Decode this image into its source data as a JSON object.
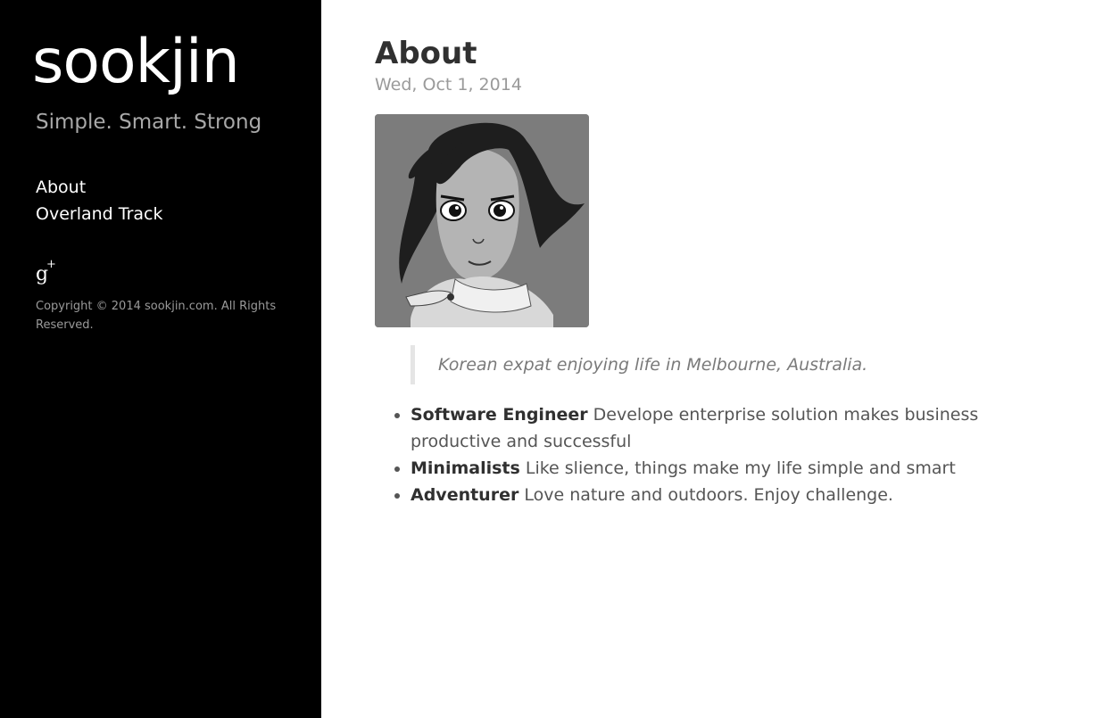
{
  "sidebar": {
    "site_title": "sookjin",
    "tagline": "Simple. Smart. Strong",
    "nav": [
      {
        "label": "About"
      },
      {
        "label": "Overland Track"
      }
    ],
    "social_icon": "google-plus-icon",
    "copyright": "Copyright © 2014 sookjin.com. All Rights Reserved."
  },
  "post": {
    "title": "About",
    "date": "Wed, Oct 1, 2014",
    "quote": "Korean expat enjoying life in Melbourne, Australia.",
    "traits": [
      {
        "term": "Software Engineer",
        "desc": " Develope enterprise solution makes business productive and successful"
      },
      {
        "term": "Minimalists",
        "desc": " Like slience, things make my life simple and smart"
      },
      {
        "term": "Adventurer",
        "desc": " Love nature and outdoors. Enjoy challenge."
      }
    ]
  },
  "colors": {
    "sidebar_bg": "#000000",
    "content_bg": "#ffffff",
    "muted_text": "#9a9a9a"
  }
}
